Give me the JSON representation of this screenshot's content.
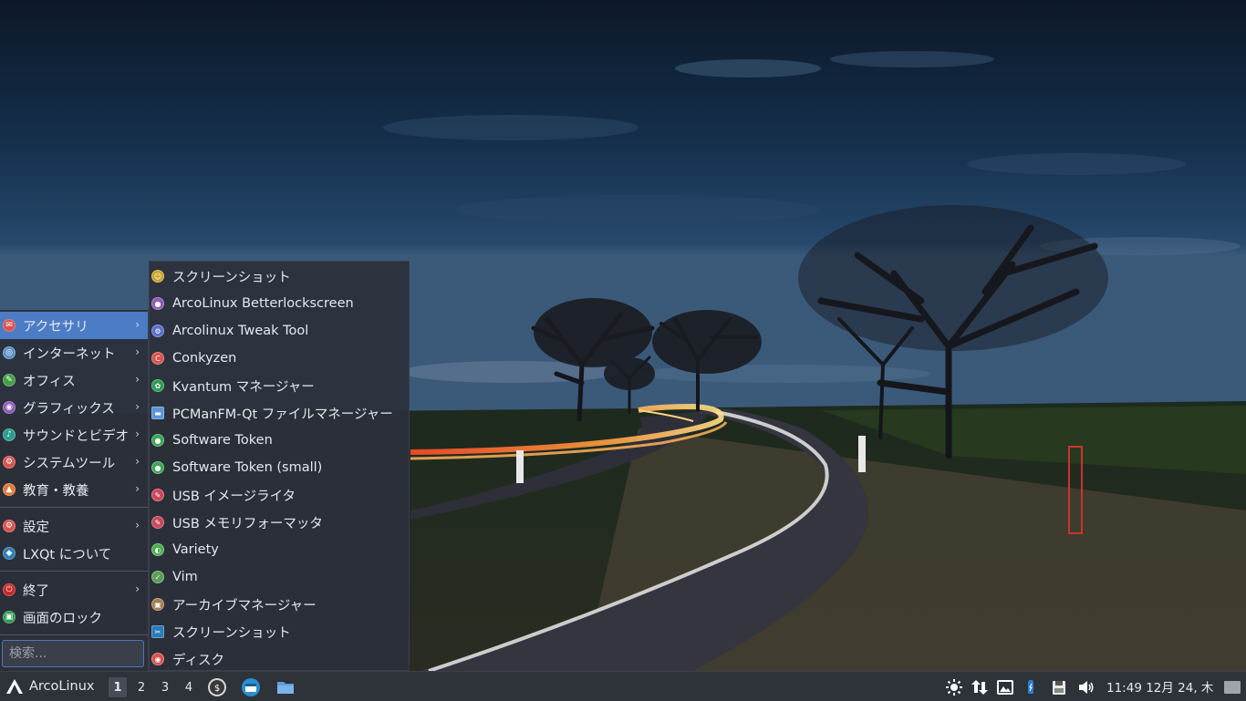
{
  "main_menu": {
    "items": [
      {
        "label": "アクセサリ",
        "color": "#d9534f",
        "glyph": "✉",
        "submenu": true
      },
      {
        "label": "インターネット",
        "color": "#5b8fc9",
        "glyph": "◎",
        "submenu": true
      },
      {
        "label": "オフィス",
        "color": "#43a047",
        "glyph": "✎",
        "submenu": true
      },
      {
        "label": "グラフィックス",
        "color": "#8e5bb5",
        "glyph": "◉",
        "submenu": true
      },
      {
        "label": "サウンドとビデオ",
        "color": "#2a9d8f",
        "glyph": "♪",
        "submenu": true
      },
      {
        "label": "システムツール",
        "color": "#d9534f",
        "glyph": "⚙",
        "submenu": true
      },
      {
        "label": "教育・教養",
        "color": "#e07b39",
        "glyph": "▲",
        "submenu": true
      }
    ],
    "settings_label": "設定",
    "about_label": "LXQt について",
    "shutdown_label": "終了",
    "lock_label": "画面のロック",
    "search_placeholder": "検索..."
  },
  "submenu": {
    "items": [
      {
        "label": "スクリーンショット",
        "color": "#c9a227",
        "glyph": "☺"
      },
      {
        "label": "ArcoLinux Betterlockscreen",
        "color": "#8e5bb5",
        "glyph": "●"
      },
      {
        "label": "Arcolinux Tweak Tool",
        "color": "#5b6fc9",
        "glyph": "⚙"
      },
      {
        "label": "Conkyzen",
        "color": "#d9534f",
        "glyph": "C"
      },
      {
        "label": "Kvantum マネージャー",
        "color": "#2e9b4f",
        "glyph": "✿"
      },
      {
        "label": "PCManFM-Qt ファイルマネージャー",
        "color": "#5b95d6",
        "glyph": "▬"
      },
      {
        "label": "Software Token",
        "color": "#3aa655",
        "glyph": "●"
      },
      {
        "label": "Software Token (small)",
        "color": "#3aa655",
        "glyph": "●"
      },
      {
        "label": "USB イメージライタ",
        "color": "#c9485b",
        "glyph": "✎"
      },
      {
        "label": "USB メモリフォーマッタ",
        "color": "#c9485b",
        "glyph": "✎"
      },
      {
        "label": "Variety",
        "color": "#4caf50",
        "glyph": "◐"
      },
      {
        "label": "Vim",
        "color": "#5a9e5a",
        "glyph": "✓"
      },
      {
        "label": "アーカイブマネージャー",
        "color": "#a67c52",
        "glyph": "▣"
      },
      {
        "label": "スクリーンショット",
        "color": "#2b7bb9",
        "glyph": "✂"
      },
      {
        "label": "ディスク",
        "color": "#d9534f",
        "glyph": "◉"
      }
    ]
  },
  "taskbar": {
    "start_label": "ArcoLinux",
    "workspaces": [
      "1",
      "2",
      "3",
      "4"
    ],
    "active_workspace": "1",
    "clock": "11:49 12月 24, 木"
  }
}
